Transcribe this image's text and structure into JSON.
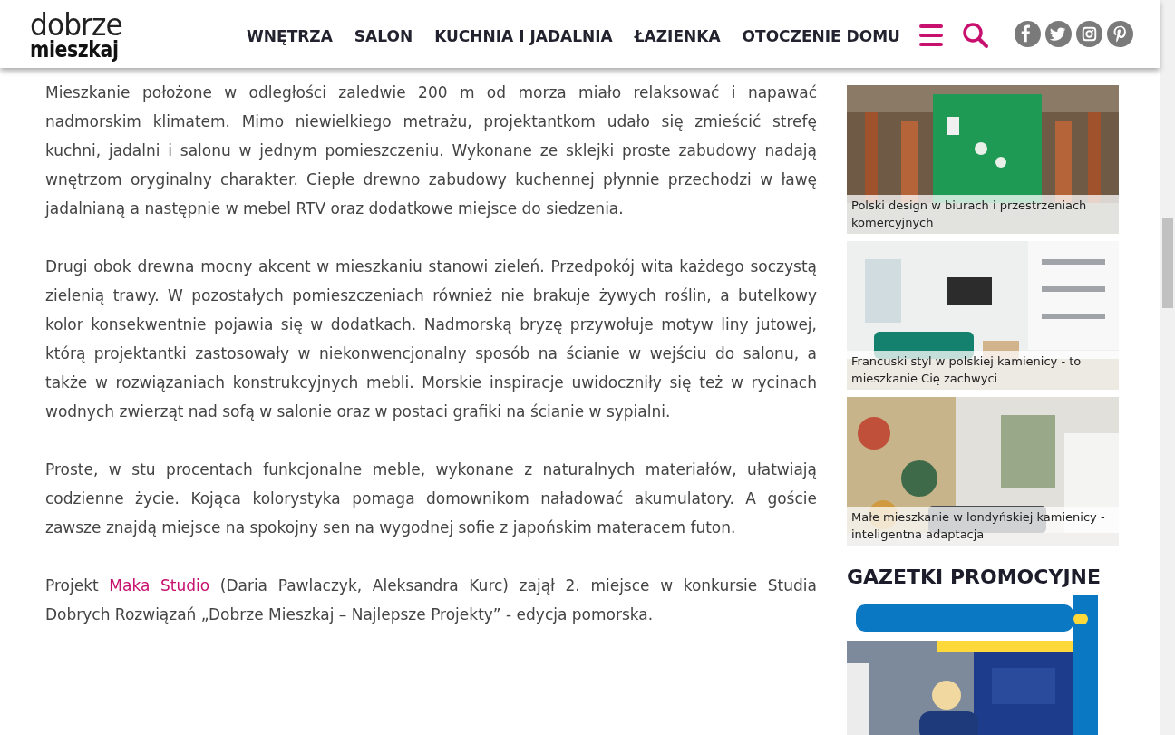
{
  "header": {
    "logo": {
      "line1": "dobrze",
      "line2": "mieszkaj"
    },
    "nav": [
      {
        "label": "WNĘTRZA"
      },
      {
        "label": "SALON"
      },
      {
        "label": "KUCHNIA I JADALNIA"
      },
      {
        "label": "ŁAZIENKA"
      },
      {
        "label": "OTOCZENIE DOMU"
      }
    ],
    "social": [
      {
        "kind": "facebook"
      },
      {
        "kind": "twitter"
      },
      {
        "kind": "instagram"
      },
      {
        "kind": "pinterest"
      }
    ]
  },
  "article": {
    "paragraphs": [
      {
        "parts": [
          {
            "text": "Mieszkanie położone w odległości zaledwie 200 m od morza miało relaksować i napawać nadmorskim klimatem. Mimo niewielkiego metrażu, projektantkom udało się zmieścić strefę kuchni, jadalni i salonu w jednym pomieszczeniu. Wykonane ze sklejki proste zabudowy nadają wnętrzom oryginalny charakter. Ciepłe drewno zabudowy kuchennej płynnie przechodzi w ławę jadalnianą a następnie w mebel RTV oraz dodatkowe miejsce do siedzenia."
          }
        ]
      },
      {
        "parts": [
          {
            "text": "Drugi obok drewna mocny akcent w mieszkaniu stanowi zieleń. Przedpokój wita każdego soczystą zielenią trawy. W pozostałych pomieszczeniach również nie brakuje żywych roślin, a butelkowy kolor konsekwentnie pojawia się w dodatkach. Nadmorską bryzę przywołuje motyw liny jutowej, którą projektantki zastosowały w niekonwencjonalny sposób na ścianie w wejściu do salonu, a także w rozwiązaniach konstrukcyjnych mebli. Morskie inspiracje uwidoczniły się też w rycinach wodnych zwierząt nad sofą w salonie oraz w postaci grafiki na ścianie w sypialni."
          }
        ]
      },
      {
        "parts": [
          {
            "text": "Proste, w stu procentach funkcjonalne meble, wykonane z naturalnych materiałów, ułatwiają codzienne życie. Kojąca kolorystyka pomaga domownikom naładować akumulatory. A goście zawsze znajdą miejsce na spokojny sen na wygodnej sofie z japońskim materacem futon."
          }
        ]
      },
      {
        "parts": [
          {
            "text": "Projekt "
          },
          {
            "text": "Maka Studio",
            "kind": "link"
          },
          {
            "text": " (Daria Pawlaczyk, Aleksandra Kurc) zajął 2. miejsce w konkursie Studia Dobrych Rozwiązań „Dobrze Mieszkaj – Najlepsze Projekty” - edycja pomorska."
          }
        ]
      }
    ]
  },
  "sidebar": {
    "cards": [
      {
        "caption": "Polski design w biurach i przestrzeniach komercyjnych"
      },
      {
        "caption": "Francuski styl w polskiej kamienicy - to mieszkanie Cię zachwyci"
      },
      {
        "caption": "Małe mieszkanie w londyńskiej kamienicy - inteligentna adaptacja"
      }
    ],
    "promo_heading": "GAZETKI PROMOCYJNE"
  }
}
